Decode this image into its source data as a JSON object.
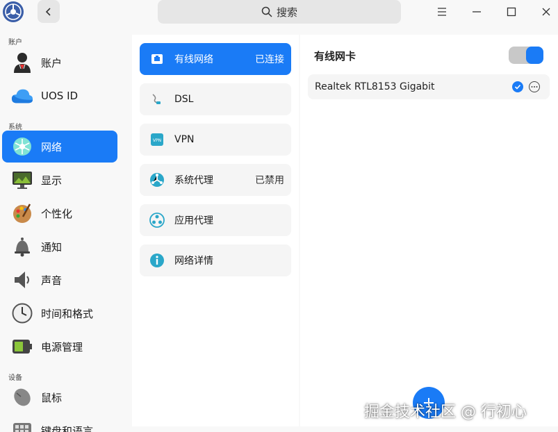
{
  "titlebar": {
    "search_placeholder": "搜索"
  },
  "sidebar": {
    "groups": [
      {
        "label": "账户"
      },
      {
        "label": "系统"
      },
      {
        "label": "设备"
      }
    ],
    "items": [
      {
        "label": "账户",
        "icon": "user-icon"
      },
      {
        "label": "UOS ID",
        "icon": "cloud-icon"
      },
      {
        "label": "网络",
        "icon": "network-icon",
        "active": true
      },
      {
        "label": "显示",
        "icon": "display-icon"
      },
      {
        "label": "个性化",
        "icon": "palette-icon"
      },
      {
        "label": "通知",
        "icon": "bell-icon"
      },
      {
        "label": "声音",
        "icon": "speaker-icon"
      },
      {
        "label": "时间和格式",
        "icon": "clock-icon"
      },
      {
        "label": "电源管理",
        "icon": "battery-icon"
      },
      {
        "label": "鼠标",
        "icon": "mouse-icon"
      },
      {
        "label": "键盘和语言",
        "icon": "keyboard-icon"
      }
    ]
  },
  "network_menu": {
    "items": [
      {
        "label": "有线网络",
        "status": "已连接",
        "icon": "wired-network-icon",
        "active": true
      },
      {
        "label": "DSL",
        "status": "",
        "icon": "dsl-icon"
      },
      {
        "label": "VPN",
        "status": "",
        "icon": "vpn-icon"
      },
      {
        "label": "系统代理",
        "status": "已禁用",
        "icon": "system-proxy-icon"
      },
      {
        "label": "应用代理",
        "status": "",
        "icon": "app-proxy-icon"
      },
      {
        "label": "网络详情",
        "status": "",
        "icon": "info-icon"
      }
    ]
  },
  "wired_panel": {
    "title": "有线网卡",
    "toggle_on": true,
    "adapter_name": "Realtek RTL8153 Gigabit"
  },
  "watermark": "掘金技术社区 @ 行初心",
  "colors": {
    "accent": "#1a7bf6"
  }
}
